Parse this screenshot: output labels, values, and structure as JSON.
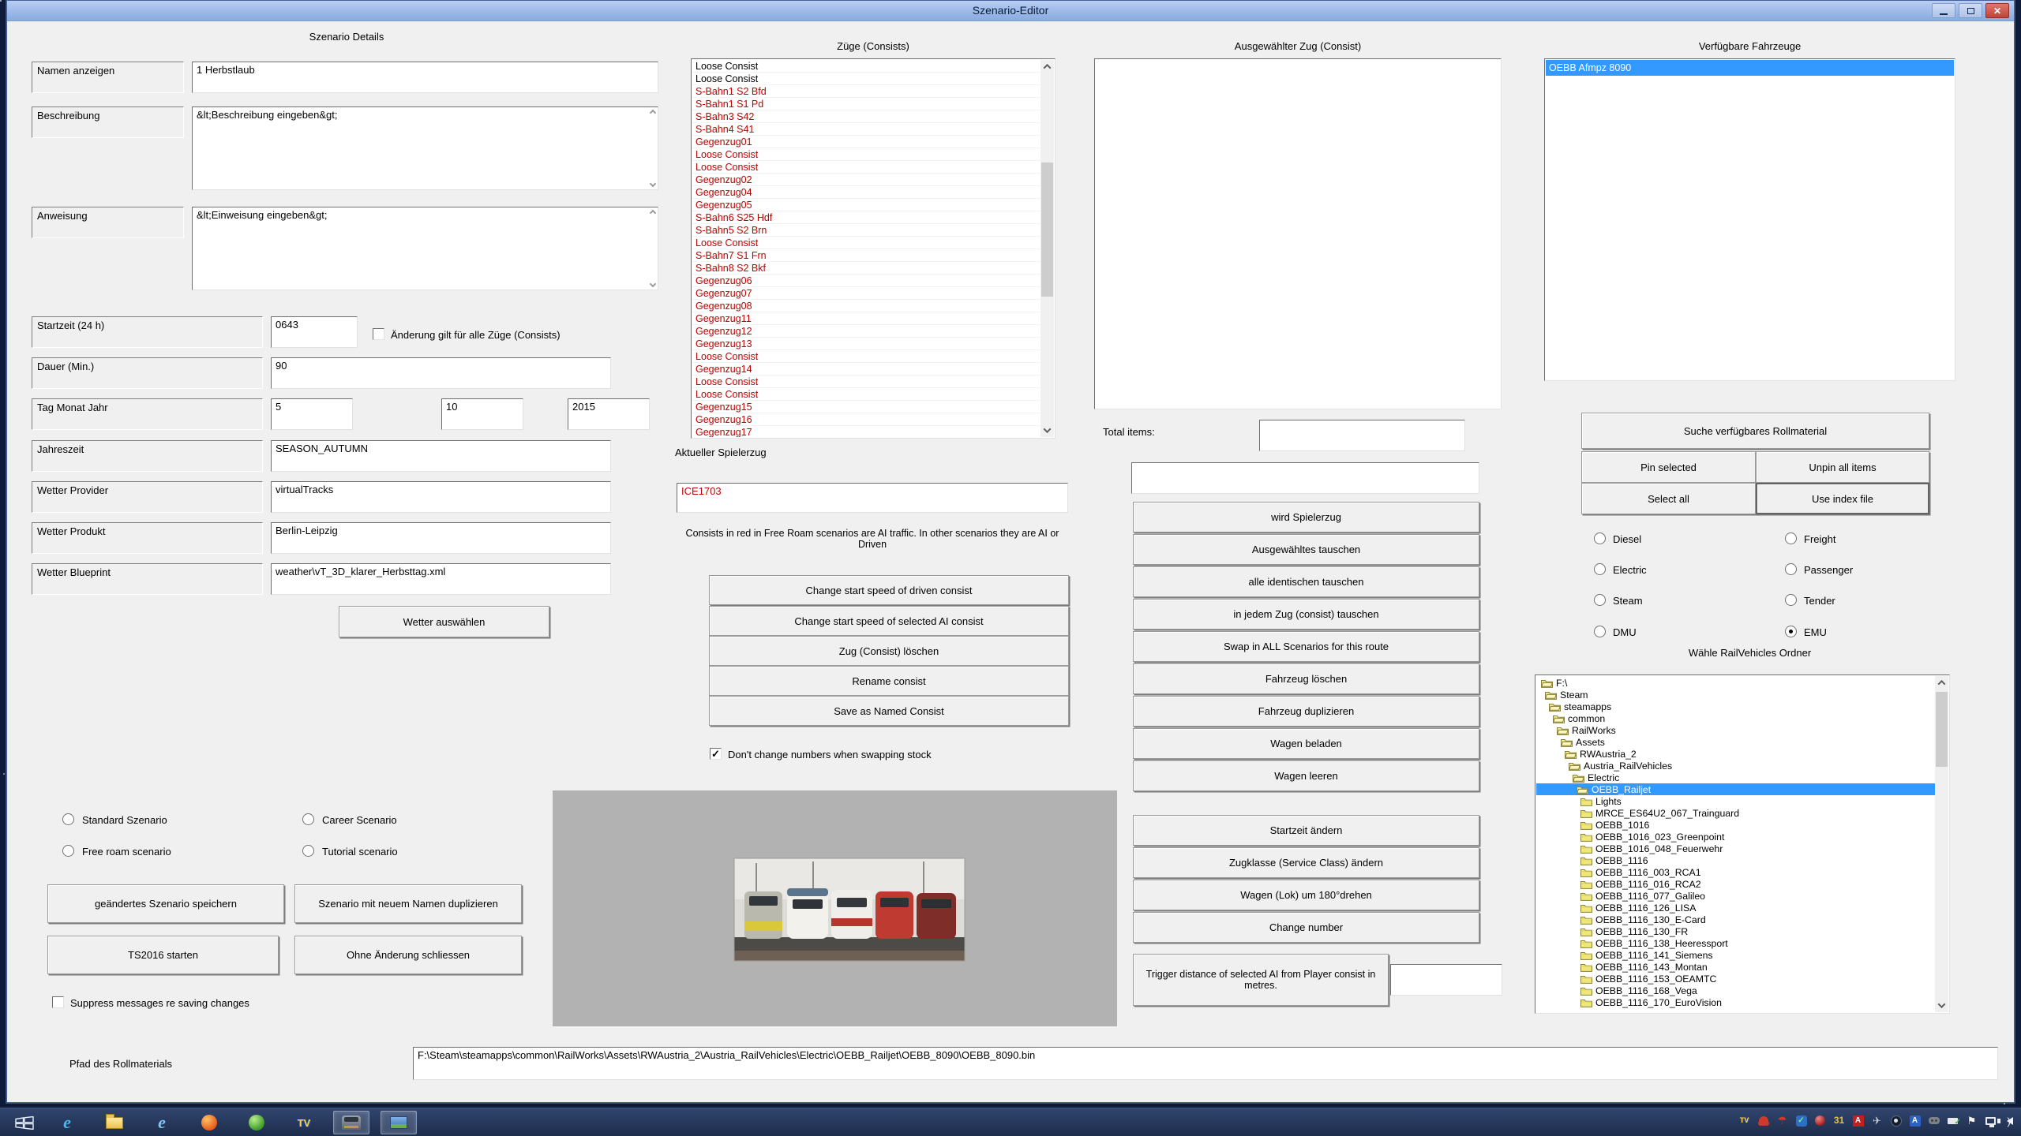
{
  "window": {
    "title": "Szenario-Editor"
  },
  "scenario": {
    "header": "Szenario Details",
    "name_label": "Namen anzeigen",
    "name_value": "1 Herbstlaub",
    "desc_label": "Beschreibung",
    "desc_value": "&lt;Beschreibung eingeben&gt;",
    "instr_label": "Anweisung",
    "instr_value": "&lt;Einweisung eingeben&gt;",
    "start_label": "Startzeit (24 h)",
    "start_value": "0643",
    "apply_all_label": "Änderung gilt für alle Züge (Consists)",
    "duration_label": "Dauer (Min.)",
    "duration_value": "90",
    "date_label": "Tag Monat Jahr",
    "day_value": "5",
    "month_value": "10",
    "year_value": "2015",
    "season_label": "Jahreszeit",
    "season_value": "SEASON_AUTUMN",
    "weather_provider_label": "Wetter Provider",
    "weather_provider_value": "virtualTracks",
    "weather_product_label": "Wetter Produkt",
    "weather_product_value": "Berlin-Leipzig",
    "weather_blueprint_label": "Wetter Blueprint",
    "weather_blueprint_value": "weather\\vT_3D_klarer_Herbsttag.xml",
    "weather_button": "Wetter auswählen",
    "radio_standard": "Standard Szenario",
    "radio_career": "Career Scenario",
    "radio_freeroam": "Free roam scenario",
    "radio_tutorial": "Tutorial scenario",
    "save_button": "geändertes Szenario speichern",
    "duplicate_button": "Szenario mit neuem Namen duplizieren",
    "start_ts_button": "TS2016 starten",
    "close_button": "Ohne Änderung schliessen",
    "suppress_label": "Suppress messages re saving changes",
    "path_label": "Pfad des Rollmaterials",
    "path_value": "F:\\Steam\\steamapps\\common\\RailWorks\\Assets\\RWAustria_2\\Austria_RailVehicles\\Electric\\OEBB_Railjet\\OEBB_8090\\OEBB_8090.bin"
  },
  "zuege": {
    "header": "Züge (Consists)",
    "items": [
      {
        "label": "Loose Consist",
        "red": false
      },
      {
        "label": "Loose Consist",
        "red": false
      },
      {
        "label": "S-Bahn1 S2 Bfd",
        "red": true
      },
      {
        "label": "S-Bahn1 S1 Pd",
        "red": true
      },
      {
        "label": "S-Bahn3 S42",
        "red": true
      },
      {
        "label": "S-Bahn4 S41",
        "red": true
      },
      {
        "label": "Gegenzug01",
        "red": true
      },
      {
        "label": "Loose Consist",
        "red": true
      },
      {
        "label": "Loose Consist",
        "red": true
      },
      {
        "label": "Gegenzug02",
        "red": true
      },
      {
        "label": "Gegenzug04",
        "red": true
      },
      {
        "label": "Gegenzug05",
        "red": true
      },
      {
        "label": "S-Bahn6 S25 Hdf",
        "red": true
      },
      {
        "label": "S-Bahn5 S2 Brn",
        "red": true
      },
      {
        "label": "Loose Consist",
        "red": true
      },
      {
        "label": "S-Bahn7 S1 Frn",
        "red": true
      },
      {
        "label": "S-Bahn8 S2 Bkf",
        "red": true
      },
      {
        "label": "Gegenzug06",
        "red": true
      },
      {
        "label": "Gegenzug07",
        "red": true
      },
      {
        "label": "Gegenzug08",
        "red": true
      },
      {
        "label": "Gegenzug11",
        "red": true
      },
      {
        "label": "Gegenzug12",
        "red": true
      },
      {
        "label": "Gegenzug13",
        "red": true
      },
      {
        "label": "Loose Consist",
        "red": true
      },
      {
        "label": "Gegenzug14",
        "red": true
      },
      {
        "label": "Loose Consist",
        "red": true
      },
      {
        "label": "Loose Consist",
        "red": true
      },
      {
        "label": "Gegenzug15",
        "red": true
      },
      {
        "label": "Gegenzug16",
        "red": true
      },
      {
        "label": "Gegenzug17",
        "red": true
      }
    ],
    "player_label": "Aktueller Spielerzug",
    "player_value": "ICE1703",
    "note": "Consists in red in Free Roam scenarios are AI traffic. In other scenarios they are AI or Driven",
    "buttons": [
      "Change start speed of driven consist",
      "Change start speed of selected AI consist",
      "Zug (Consist) löschen",
      "Rename consist",
      "Save as Named Consist"
    ],
    "dont_change_label": "Don't change numbers when swapping stock"
  },
  "selected_consist": {
    "header": "Ausgewählter Zug (Consist)",
    "total_items_label": "Total items:",
    "total_items_value": "",
    "info_value": "",
    "buttons": [
      "wird Spielerzug",
      "Ausgewähltes tauschen",
      "alle identischen tauschen",
      "in jedem Zug (consist) tauschen",
      "Swap in ALL Scenarios for this route",
      "Fahrzeug löschen",
      "Fahrzeug duplizieren",
      "Wagen beladen",
      "Wagen leeren"
    ],
    "buttons2": [
      "Startzeit ändern",
      "Zugklasse (Service Class) ändern",
      "Wagen (Lok) um 180°drehen",
      "Change number"
    ],
    "trigger_label": "Trigger distance of selected AI from Player consist in metres.",
    "trigger_value": ""
  },
  "vehicles": {
    "header": "Verfügbare Fahrzeuge",
    "items": [
      {
        "label": "OEBB Afmpz 8090",
        "selected": true
      }
    ],
    "search_button": "Suche verfügbares Rollmaterial",
    "pin_button": "Pin selected",
    "unpin_button": "Unpin all items",
    "select_all_button": "Select all",
    "index_button": "Use index file",
    "radios": [
      {
        "label": "Diesel",
        "selected": false
      },
      {
        "label": "Freight",
        "selected": false
      },
      {
        "label": "Electric",
        "selected": false
      },
      {
        "label": "Passenger",
        "selected": false
      },
      {
        "label": "Steam",
        "selected": false
      },
      {
        "label": "Tender",
        "selected": false
      },
      {
        "label": "DMU",
        "selected": false
      },
      {
        "label": "EMU",
        "selected": true
      }
    ],
    "folder_label": "Wähle RailVehicles Ordner",
    "tree": [
      {
        "label": "F:\\",
        "level": 0,
        "open": true,
        "selected": false
      },
      {
        "label": "Steam",
        "level": 1,
        "open": true,
        "selected": false
      },
      {
        "label": "steamapps",
        "level": 2,
        "open": true,
        "selected": false
      },
      {
        "label": "common",
        "level": 3,
        "open": true,
        "selected": false
      },
      {
        "label": "RailWorks",
        "level": 4,
        "open": true,
        "selected": false
      },
      {
        "label": "Assets",
        "level": 5,
        "open": true,
        "selected": false
      },
      {
        "label": "RWAustria_2",
        "level": 6,
        "open": true,
        "selected": false
      },
      {
        "label": "Austria_RailVehicles",
        "level": 7,
        "open": true,
        "selected": false
      },
      {
        "label": "Electric",
        "level": 8,
        "open": true,
        "selected": false
      },
      {
        "label": "OEBB_Railjet",
        "level": 9,
        "open": true,
        "selected": true
      },
      {
        "label": "Lights",
        "level": 10,
        "open": false,
        "selected": false
      },
      {
        "label": "MRCE_ES64U2_067_Trainguard",
        "level": 10,
        "open": false,
        "selected": false
      },
      {
        "label": "OEBB_1016",
        "level": 10,
        "open": false,
        "selected": false
      },
      {
        "label": "OEBB_1016_023_Greenpoint",
        "level": 10,
        "open": false,
        "selected": false
      },
      {
        "label": "OEBB_1016_048_Feuerwehr",
        "level": 10,
        "open": false,
        "selected": false
      },
      {
        "label": "OEBB_1116",
        "level": 10,
        "open": false,
        "selected": false
      },
      {
        "label": "OEBB_1116_003_RCA1",
        "level": 10,
        "open": false,
        "selected": false
      },
      {
        "label": "OEBB_1116_016_RCA2",
        "level": 10,
        "open": false,
        "selected": false
      },
      {
        "label": "OEBB_1116_077_Galileo",
        "level": 10,
        "open": false,
        "selected": false
      },
      {
        "label": "OEBB_1116_126_LISA",
        "level": 10,
        "open": false,
        "selected": false
      },
      {
        "label": "OEBB_1116_130_E-Card",
        "level": 10,
        "open": false,
        "selected": false
      },
      {
        "label": "OEBB_1116_130_FR",
        "level": 10,
        "open": false,
        "selected": false
      },
      {
        "label": "OEBB_1116_138_Heeressport",
        "level": 10,
        "open": false,
        "selected": false
      },
      {
        "label": "OEBB_1116_141_Siemens",
        "level": 10,
        "open": false,
        "selected": false
      },
      {
        "label": "OEBB_1116_143_Montan",
        "level": 10,
        "open": false,
        "selected": false
      },
      {
        "label": "OEBB_1116_153_OEAMTC",
        "level": 10,
        "open": false,
        "selected": false
      },
      {
        "label": "OEBB_1116_168_Vega",
        "level": 10,
        "open": false,
        "selected": false
      },
      {
        "label": "OEBB_1116_170_EuroVision",
        "level": 10,
        "open": false,
        "selected": false
      }
    ]
  },
  "taskbar": {
    "apps": [
      {
        "icon": "internet-explorer-icon",
        "active": false
      },
      {
        "icon": "file-explorer-icon",
        "active": false
      },
      {
        "icon": "browser-e-icon",
        "active": false
      },
      {
        "icon": "firefox-icon",
        "active": false
      },
      {
        "icon": "green-app-icon",
        "active": false
      },
      {
        "icon": "tv-app-icon",
        "active": false
      },
      {
        "icon": "scenario-editor-app-icon",
        "active": true
      },
      {
        "icon": "train-simulator-app-icon",
        "active": true
      }
    ],
    "tray": [
      "tv-tray-icon",
      "red-dots-icon",
      "avira-umbrella-icon",
      "blue-check-icon",
      "red-sphere-icon",
      "calendar-icon",
      "adobe-icon",
      "bird-icon",
      "steam-icon",
      "blue-a-icon",
      "gamepad-icon",
      "usb-eject-icon",
      "action-center-flag-icon",
      "network-icon",
      "volume-icon"
    ],
    "calendar_value": "31"
  },
  "colors": {
    "selection_blue": "#3399ff",
    "ai_consist_red": "#c00000",
    "titlebar_blue": "#9cb9e8",
    "taskbar_navy": "#24365c"
  }
}
